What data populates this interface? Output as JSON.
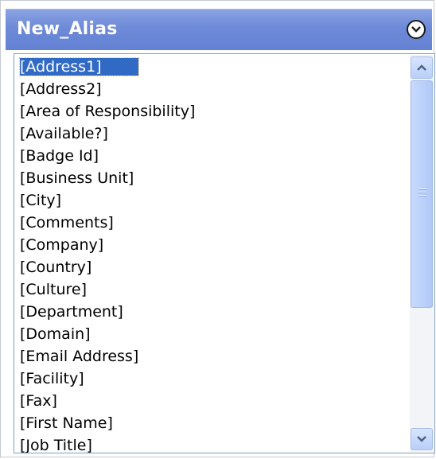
{
  "header": {
    "title": "New_Alias"
  },
  "list": {
    "selected_index": 0,
    "items": [
      "[Address1]",
      "[Address2]",
      "[Area of Responsibility]",
      "[Available?]",
      "[Badge Id]",
      "[Business Unit]",
      "[City]",
      "[Comments]",
      "[Company]",
      "[Country]",
      "[Culture]",
      "[Department]",
      "[Domain]",
      "[Email Address]",
      "[Facility]",
      "[Fax]",
      "[First Name]",
      "[Job Title]"
    ]
  },
  "colors": {
    "header_bg": "#6e8ad8",
    "selection": "#316ac5",
    "scrollbar": "#bcd2fb"
  },
  "icons": {
    "collapse": "chevron-down-circle-icon",
    "scroll_up": "arrow-up-icon",
    "scroll_down": "arrow-down-icon"
  }
}
